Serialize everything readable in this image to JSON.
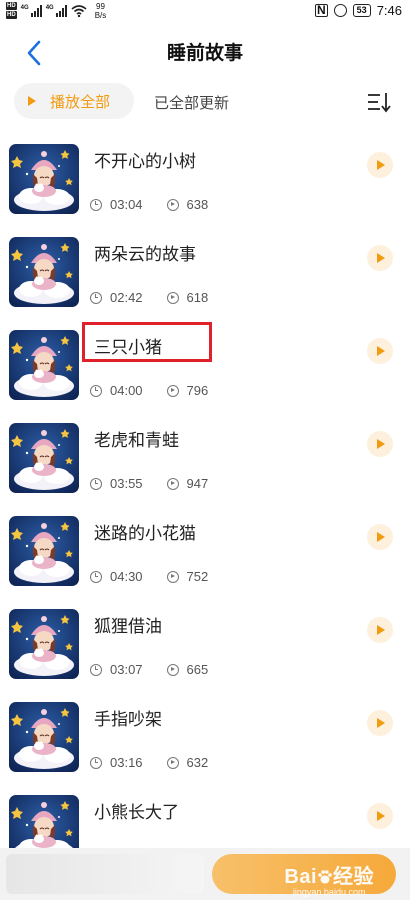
{
  "status_bar": {
    "hd1": "HD",
    "hd2": "HD",
    "net1": "4G",
    "net2": "4G",
    "speed_value": "99",
    "speed_unit": "B/s",
    "nfc": "N",
    "battery": "53",
    "time": "7:46"
  },
  "header": {
    "title": "睡前故事"
  },
  "toolbar": {
    "play_all_label": "播放全部",
    "update_status": "已全部更新"
  },
  "stories": [
    {
      "title": "不开心的小树",
      "duration": "03:04",
      "plays": "638"
    },
    {
      "title": "两朵云的故事",
      "duration": "02:42",
      "plays": "618"
    },
    {
      "title": "三只小猪",
      "duration": "04:00",
      "plays": "796"
    },
    {
      "title": "老虎和青蛙",
      "duration": "03:55",
      "plays": "947"
    },
    {
      "title": "迷路的小花猫",
      "duration": "04:30",
      "plays": "752"
    },
    {
      "title": "狐狸借油",
      "duration": "03:07",
      "plays": "665"
    },
    {
      "title": "手指吵架",
      "duration": "03:16",
      "plays": "632"
    },
    {
      "title": "小熊长大了",
      "duration": "",
      "plays": ""
    }
  ],
  "watermark": {
    "logo_a": "Bai",
    "logo_b": "经验",
    "url": "jingyan.baidu.com"
  },
  "colors": {
    "accent": "#f29b12",
    "highlight": "#e0202a",
    "back_arrow": "#1e6fe0"
  }
}
